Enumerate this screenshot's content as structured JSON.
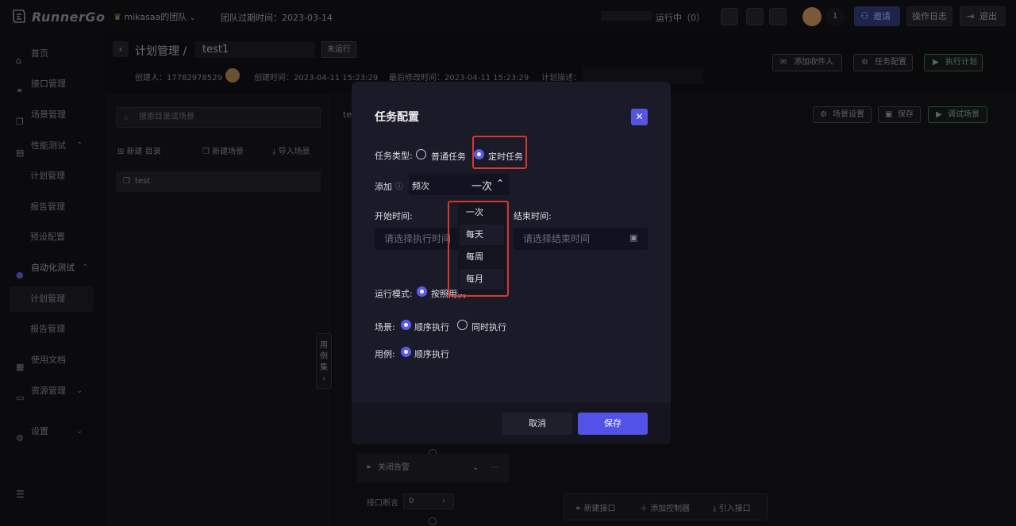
{
  "app": {
    "logo_text": "RunnerGo",
    "team_name": "mikasaa的团队",
    "team_expire": "团队过期时间：2023-03-14",
    "running_label": "运行中（0）",
    "user_count": "1",
    "invite_label": "邀请",
    "log_label": "操作日志",
    "exit_label": "退出"
  },
  "sidebar": {
    "items": [
      {
        "label": "首页"
      },
      {
        "label": "接口管理"
      },
      {
        "label": "场景管理"
      },
      {
        "label": "性能测试"
      },
      {
        "label": "计划管理"
      },
      {
        "label": "报告管理"
      },
      {
        "label": "预设配置"
      },
      {
        "label": "自动化测试"
      },
      {
        "label": "计划管理"
      },
      {
        "label": "报告管理"
      },
      {
        "label": "使用文档"
      },
      {
        "label": "资源管理"
      },
      {
        "label": "设置"
      }
    ]
  },
  "header": {
    "crumb": "计划管理 /",
    "plan_name": "test1",
    "status": "未运行",
    "creator": "创建人：17782978529",
    "created": "创建时间：2023-04-11 15:23:29",
    "modified": "最后修改时间：2023-04-11 15:23:29",
    "desc_label": "计划描述：",
    "add_recipient": "添加收件人",
    "task_config": "任务配置",
    "run_plan": "执行计划"
  },
  "left_panel": {
    "search_placeholder": "搜索目录或场景",
    "new_folder": "新建 目录",
    "new_scene": "新建场景",
    "import_scene": "导入场景",
    "item": "test"
  },
  "canvas": {
    "tab_prefix": "te",
    "scene_settings": "场景设置",
    "save": "保存",
    "debug_scene": "调试场景",
    "side_tab": "用例集",
    "node_label": "关闭告警",
    "assert_label": "接口断言",
    "assert_value": "0",
    "new_api": "新建接口",
    "add_controller": "添加控制器",
    "import_api": "引入接口"
  },
  "modal": {
    "title": "任务配置",
    "task_type_label": "任务类型:",
    "task_type_options": [
      "普通任务",
      "定时任务"
    ],
    "task_type_selected": "定时任务",
    "add_label": "添加",
    "freq_label": "频次",
    "freq_value": "一次",
    "start_label": "开始时间:",
    "start_placeholder": "请选择执行时间",
    "end_label": "结束时间:",
    "end_placeholder": "请选择结束时间",
    "run_mode_label": "运行模式:",
    "run_mode_value": "按照用例",
    "scene_label": "场景:",
    "scene_options": [
      "顺序执行",
      "同时执行"
    ],
    "case_label": "用例:",
    "case_option": "顺序执行",
    "cancel": "取消",
    "save": "保存",
    "freq_options": [
      "一次",
      "每天",
      "每周",
      "每月"
    ]
  },
  "colors": {
    "accent": "#5252e8",
    "highlight_border": "#d8382a",
    "modal_bg": "#1a1a29"
  }
}
